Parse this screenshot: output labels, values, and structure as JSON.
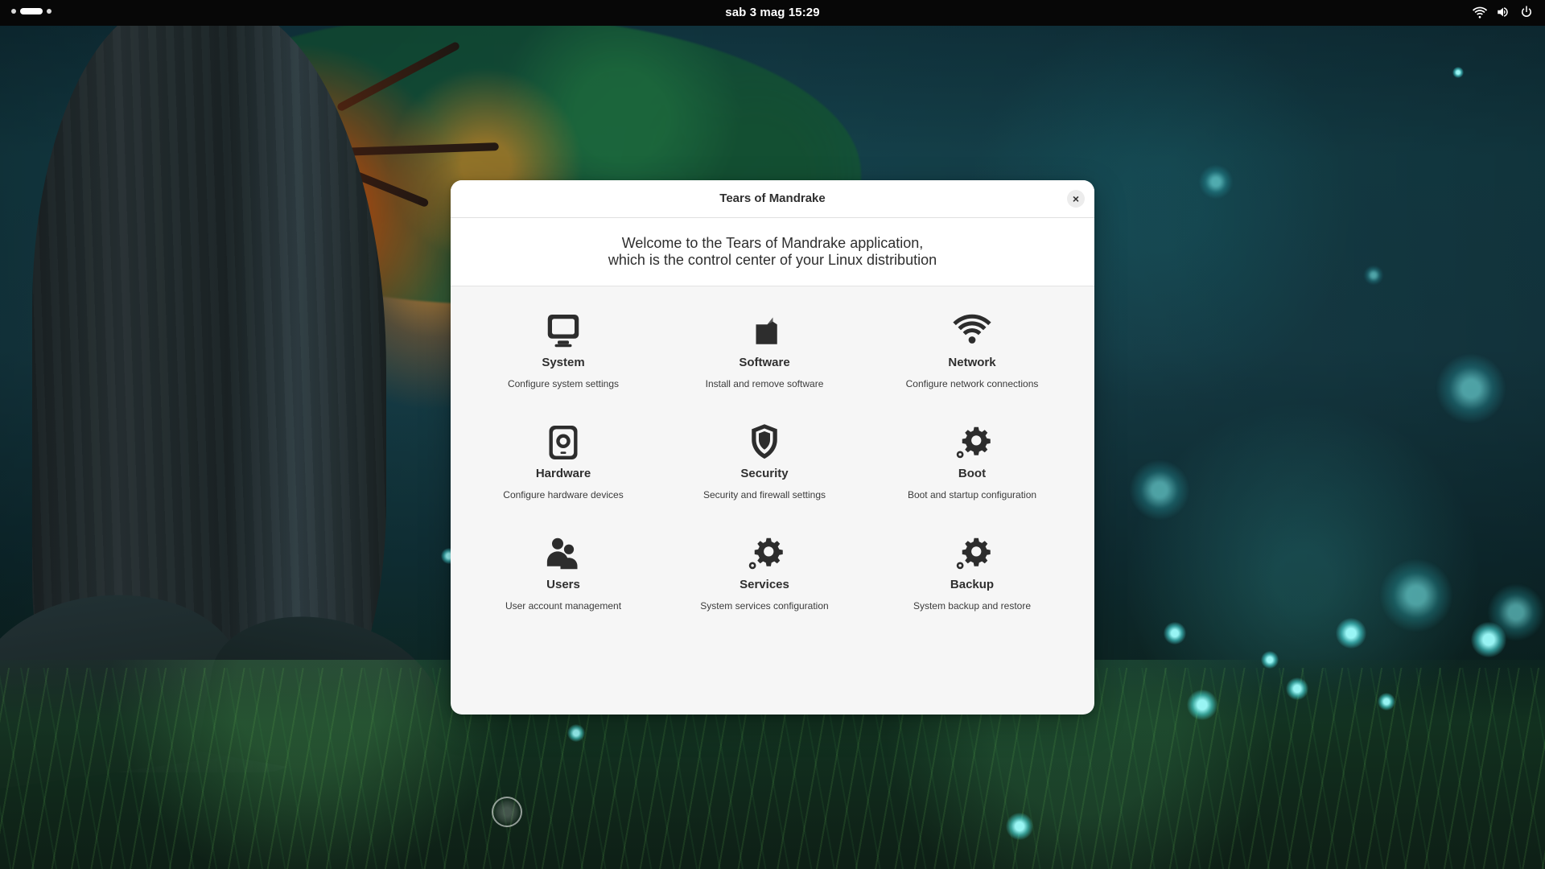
{
  "topbar": {
    "clock": "sab 3 mag  15:29",
    "icons": [
      {
        "name": "wifi-icon"
      },
      {
        "name": "volume-icon"
      },
      {
        "name": "power-icon"
      }
    ]
  },
  "window": {
    "title": "Tears of Mandrake",
    "close_label": "×",
    "welcome_line_1": "Welcome to the Tears of Mandrake application,",
    "welcome_line_2": "which is the control center of your Linux distribution"
  },
  "items": [
    {
      "label": "System",
      "desc": "Configure system settings",
      "icon": "monitor-icon"
    },
    {
      "label": "Software",
      "desc": "Install and remove software",
      "icon": "package-icon"
    },
    {
      "label": "Network",
      "desc": "Configure network connections",
      "icon": "wifi-icon"
    },
    {
      "label": "Hardware",
      "desc": "Configure hardware devices",
      "icon": "hardware-icon"
    },
    {
      "label": "Security",
      "desc": "Security and firewall settings",
      "icon": "shield-icon"
    },
    {
      "label": "Boot",
      "desc": "Boot and startup configuration",
      "icon": "gear-icon"
    },
    {
      "label": "Users",
      "desc": "User account management",
      "icon": "users-icon"
    },
    {
      "label": "Services",
      "desc": "System services configuration",
      "icon": "gear-icon"
    },
    {
      "label": "Backup",
      "desc": "System backup and restore",
      "icon": "gear-icon"
    }
  ],
  "colors": {
    "window_bg": "#f6f6f6",
    "window_header_bg": "#ffffff",
    "text_primary": "#2f2f2f",
    "topbar_bg": "#070707",
    "glow_cyan": "#50f0f0",
    "tree_orange": "#ff8c1a"
  }
}
